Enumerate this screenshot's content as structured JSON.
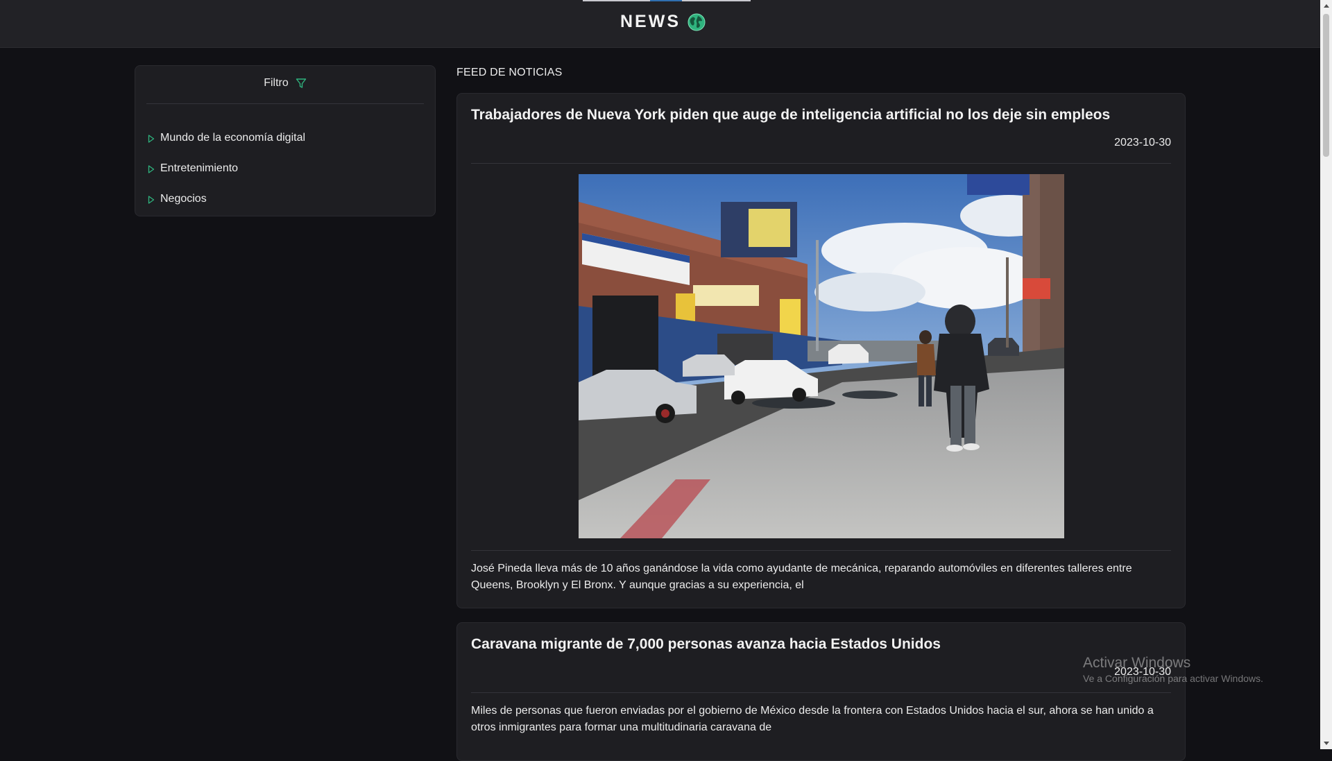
{
  "header": {
    "title": "NEWS",
    "icon": "globe-icon"
  },
  "filter": {
    "title": "Filtro",
    "icon": "filter-icon",
    "items": [
      {
        "label": "Mundo de la economía digital"
      },
      {
        "label": "Entretenimiento"
      },
      {
        "label": "Negocios"
      }
    ]
  },
  "feed": {
    "title": "FEED DE NOTICIAS",
    "articles": [
      {
        "title": "Trabajadores de Nueva York piden que auge de inteligencia artificial no los deje sin empleos",
        "date": "2023-10-30",
        "image": "street-photo",
        "excerpt": "José Pineda lleva más de 10 años ganándose la vida como ayudante de mecánica, reparando automóviles en diferentes talleres entre Queens, Brooklyn y El Bronx. Y aunque gracias a su experiencia, el"
      },
      {
        "title": "Caravana migrante de 7,000 personas avanza hacia Estados Unidos",
        "date": "2023-10-30",
        "excerpt": "Miles de personas que fueron enviadas por el gobierno de México desde la frontera con Estados Unidos hacia el sur, ahora se han unido a otros inmigrantes para formar una multitudinaria caravana de"
      }
    ]
  },
  "watermark": {
    "title": "Activar Windows",
    "subtitle": "Ve a Configuración para activar Windows."
  },
  "colors": {
    "accent": "#2fb37e",
    "background": "#111115",
    "card": "#1e1e22",
    "header": "#222226"
  }
}
